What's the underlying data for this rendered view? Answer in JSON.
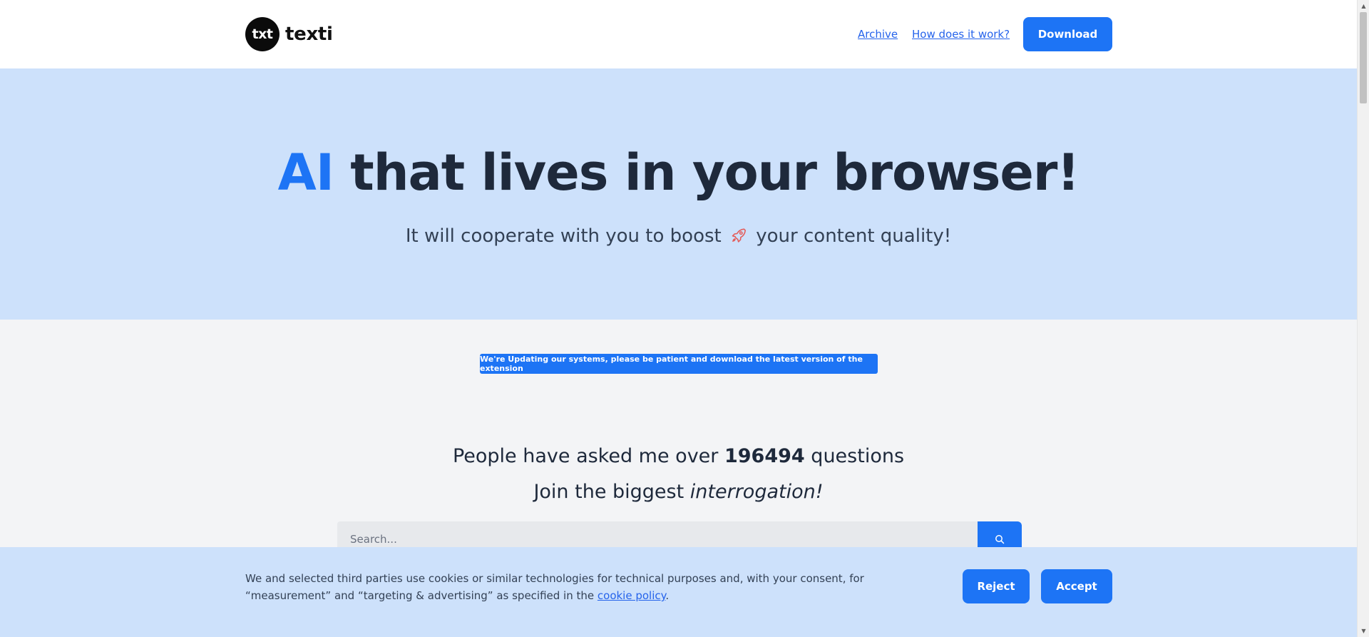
{
  "header": {
    "logo_mark": "txt",
    "logo_text": "texti",
    "nav": [
      {
        "label": "Archive"
      },
      {
        "label": "How does it work?"
      }
    ],
    "download_label": "Download"
  },
  "hero": {
    "title_accent": "AI",
    "title_rest": " that lives in your browser!",
    "subtitle_before": "It will cooperate with you to boost",
    "subtitle_after": "your content quality!",
    "rocket_icon": "rocket-icon"
  },
  "notice": "We're Updating our systems, please be patient and download the latest version of the extension",
  "stats": {
    "before": "People have asked me over ",
    "count": "196494",
    "after": " questions",
    "join_before": "Join the biggest ",
    "join_em": "interrogation!"
  },
  "search": {
    "placeholder": "Search...",
    "button_icon": "search-icon"
  },
  "cookie": {
    "text": "We and selected third parties use cookies or similar technologies for technical purposes and, with your consent, for “measurement” and “targeting & advertising” as specified in the ",
    "link": "cookie policy",
    "end": ".",
    "reject_label": "Reject",
    "accept_label": "Accept"
  },
  "colors": {
    "accent": "#1d74f5",
    "hero_bg": "#cde1fb",
    "page_bg": "#f3f4f6",
    "text_dark": "#1e293b"
  }
}
